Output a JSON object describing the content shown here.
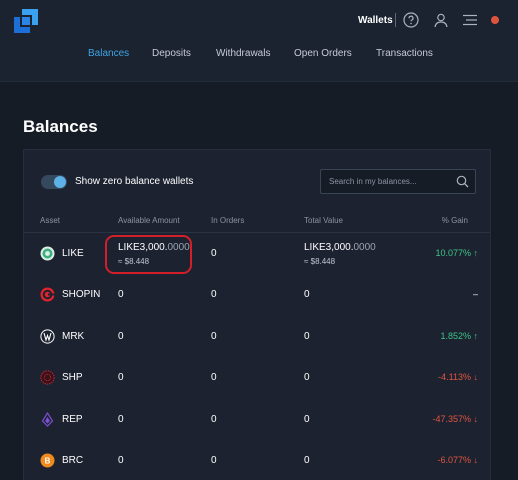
{
  "header": {
    "wallets_label": "Wallets",
    "icons": [
      "logo-icon",
      "help-icon",
      "user-icon",
      "menu-icon",
      "notification-dot-icon"
    ]
  },
  "nav": {
    "tabs": [
      {
        "label": "Balances",
        "active": true
      },
      {
        "label": "Deposits",
        "active": false
      },
      {
        "label": "Withdrawals",
        "active": false
      },
      {
        "label": "Open Orders",
        "active": false
      },
      {
        "label": "Transactions",
        "active": false
      }
    ]
  },
  "page": {
    "title": "Balances"
  },
  "controls": {
    "toggle_label": "Show zero balance wallets",
    "toggle_on": true,
    "search_placeholder": "Search in my balances..."
  },
  "table": {
    "columns": [
      "Asset",
      "Available Amount",
      "In Orders",
      "Total Value",
      "% Gain"
    ],
    "rows": [
      {
        "asset": "LIKE",
        "available": {
          "main": "LIKE3,000.",
          "frac": "0000",
          "usd": "≈ $8.448"
        },
        "in_orders": "0",
        "total": {
          "main": "LIKE3,000.",
          "frac": "0000",
          "usd": "≈ $8.448"
        },
        "gain": "10.077%",
        "gain_arrow": "↑",
        "gain_dir": "up",
        "icon": "like-coin-icon",
        "icon_color": "#3fae80"
      },
      {
        "asset": "SHOPIN",
        "available": {
          "main": "0",
          "frac": "",
          "usd": ""
        },
        "in_orders": "0",
        "total": {
          "main": "0",
          "frac": "",
          "usd": ""
        },
        "gain": "–",
        "gain_arrow": "",
        "gain_dir": "none",
        "icon": "shopin-coin-icon",
        "icon_color": "#e0242c"
      },
      {
        "asset": "MRK",
        "available": {
          "main": "0",
          "frac": "",
          "usd": ""
        },
        "in_orders": "0",
        "total": {
          "main": "0",
          "frac": "",
          "usd": ""
        },
        "gain": "1.852%",
        "gain_arrow": "↑",
        "gain_dir": "up",
        "icon": "mrk-coin-icon",
        "icon_color": "#ffffff"
      },
      {
        "asset": "SHP",
        "available": {
          "main": "0",
          "frac": "",
          "usd": ""
        },
        "in_orders": "0",
        "total": {
          "main": "0",
          "frac": "",
          "usd": ""
        },
        "gain": "-4.113%",
        "gain_arrow": "↓",
        "gain_dir": "down",
        "icon": "shp-coin-icon",
        "icon_color": "#c8283a"
      },
      {
        "asset": "REP",
        "available": {
          "main": "0",
          "frac": "",
          "usd": ""
        },
        "in_orders": "0",
        "total": {
          "main": "0",
          "frac": "",
          "usd": ""
        },
        "gain": "-47.357%",
        "gain_arrow": "↓",
        "gain_dir": "down",
        "icon": "rep-coin-icon",
        "icon_color": "#7b4fd1"
      },
      {
        "asset": "BRC",
        "available": {
          "main": "0",
          "frac": "",
          "usd": ""
        },
        "in_orders": "0",
        "total": {
          "main": "0",
          "frac": "",
          "usd": ""
        },
        "gain": "-6.077%",
        "gain_arrow": "↓",
        "gain_dir": "down",
        "icon": "brc-coin-icon",
        "icon_color": "#f08a1c"
      }
    ]
  },
  "colors": {
    "accent": "#3fa4e4",
    "gain_up": "#3cc68a",
    "gain_down": "#e2553f",
    "annotation_circle": "#d31f2a"
  }
}
